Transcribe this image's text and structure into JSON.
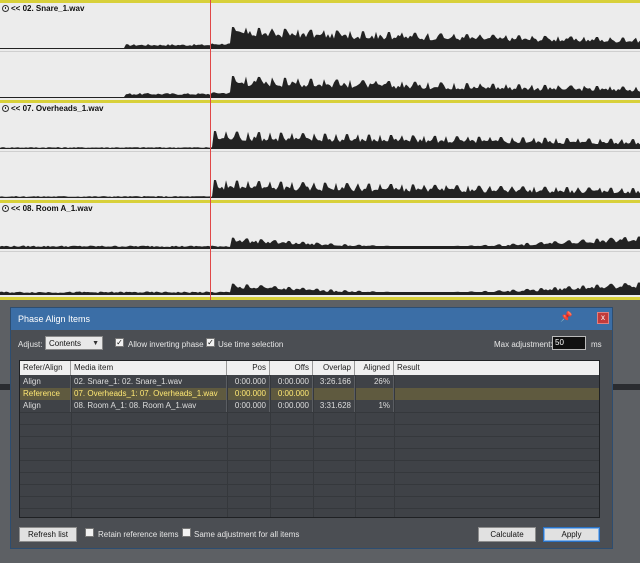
{
  "tracks": [
    {
      "name": "<< 02. Snare_1.wav"
    },
    {
      "name": "<< 07. Overheads_1.wav"
    },
    {
      "name": "<< 08. Room A_1.wav"
    }
  ],
  "dialog": {
    "title": "Phase Align Items",
    "adjust_label": "Adjust:",
    "adjust_value": "Contents",
    "allow_inverting_label": "Allow inverting phase",
    "allow_inverting_checked": true,
    "use_time_selection_label": "Use time selection",
    "use_time_selection_checked": true,
    "max_adjustment_label": "Max adjustment:",
    "max_adjustment_value": "50",
    "max_adjustment_unit": "ms",
    "columns": [
      "Refer/Align",
      "Media item",
      "Pos",
      "Offs",
      "Overlap",
      "Aligned",
      "Result"
    ],
    "rows": [
      {
        "role": "Align",
        "item": "02. Snare_1: 02. Snare_1.wav",
        "pos": "0:00.000",
        "offs": "0:00.000",
        "overlap": "3:26.166",
        "aligned": "26%",
        "result": ""
      },
      {
        "role": "Reference",
        "item": "07. Overheads_1: 07. Overheads_1.wav",
        "pos": "0:00.000",
        "offs": "0:00.000",
        "overlap": "",
        "aligned": "",
        "result": ""
      },
      {
        "role": "Align",
        "item": "08. Room A_1: 08. Room A_1.wav",
        "pos": "0:00.000",
        "offs": "0:00.000",
        "overlap": "3:31.628",
        "aligned": "1%",
        "result": ""
      }
    ],
    "refresh_label": "Refresh list",
    "retain_label": "Retain reference items",
    "same_adjust_label": "Same adjustment for all items",
    "calculate_label": "Calculate",
    "apply_label": "Apply",
    "close_glyph": "x",
    "pin_glyph": "📌"
  },
  "colors": {
    "accent": "#3b6ea6",
    "selected_row": "#5f5a3f",
    "cursor": "#e04848",
    "track_border": "#d8d03a"
  }
}
